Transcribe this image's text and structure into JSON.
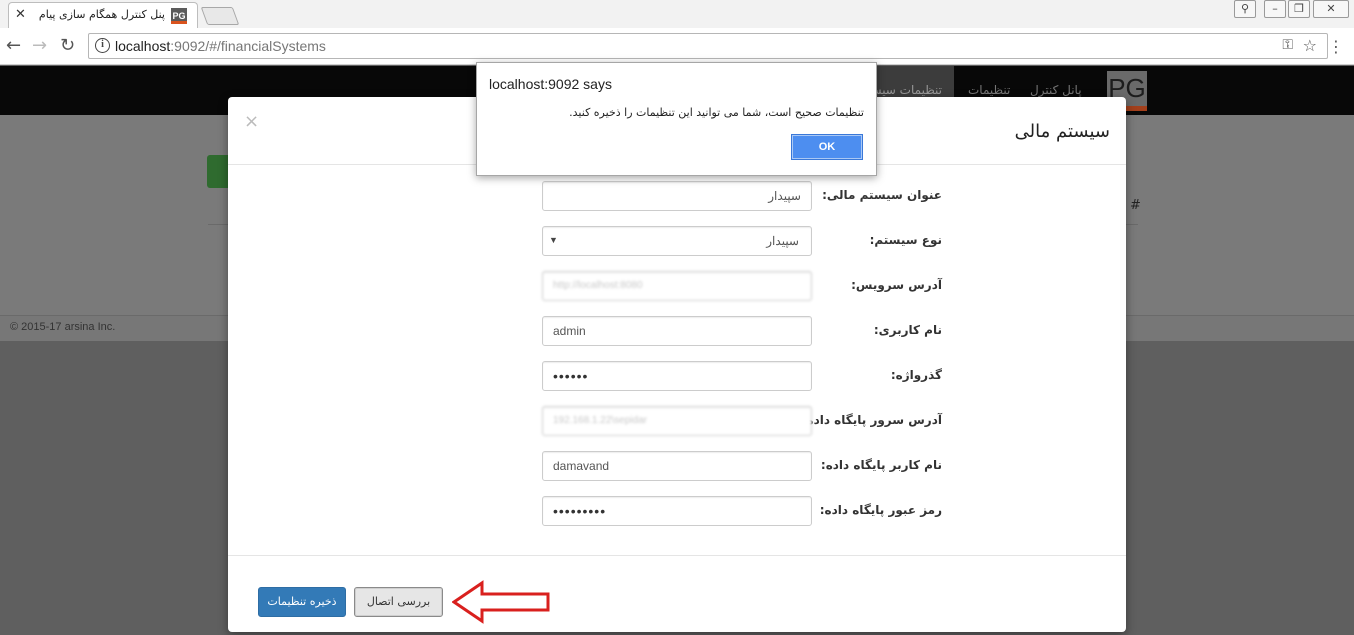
{
  "browser": {
    "tab_title": "پنل کنترل همگام سازی پیام",
    "tab_favicon": "PG",
    "url_host": "localhost",
    "url_rest": ":9092/#/financialSystems"
  },
  "app": {
    "logo": "PG",
    "nav": {
      "control_panel": "پانل کنترل",
      "settings": "تنظیمات",
      "system_settings": "تنظیمات سیستم"
    },
    "table_hash": "#",
    "footer": "© 2015-17 arsina Inc."
  },
  "modal": {
    "title": "سیستم مالی",
    "close_glyph": "×",
    "fields": [
      {
        "label": "عنوان سیستم مالی:",
        "value": "سپیدار",
        "dir": "rtl"
      },
      {
        "label": "نوع سیستم:",
        "value": "سپیدار",
        "type": "select"
      },
      {
        "label": "آدرس سرویس:",
        "value": "http://localhost:8080",
        "dir": "ltr",
        "blurred": true
      },
      {
        "label": "نام کاربری:",
        "value": "admin",
        "dir": "ltr"
      },
      {
        "label": "گذرواژه:",
        "value": "••••••",
        "type": "password"
      },
      {
        "label": "آدرس سرور پایگاه داده:",
        "value": "192.168.1.22\\sepidar",
        "dir": "ltr",
        "blurred": true
      },
      {
        "label": "نام کاربر پایگاه داده:",
        "value": "damavand",
        "dir": "ltr"
      },
      {
        "label": "رمز عبور پایگاه داده:",
        "value": "•••••••••",
        "type": "password"
      }
    ],
    "save_button": "ذخیره تنظیمات",
    "check_button": "بررسی اتصال"
  },
  "alert": {
    "title": "localhost:9092 says",
    "message": "تنظیمات صحیح است، شما می توانید این تنظیمات را ذخیره کنید.",
    "ok_button": "OK"
  },
  "colors": {
    "primary": "#337ab7",
    "alert_ok": "#4d8ef0",
    "annotation_arrow": "#d9201e"
  }
}
